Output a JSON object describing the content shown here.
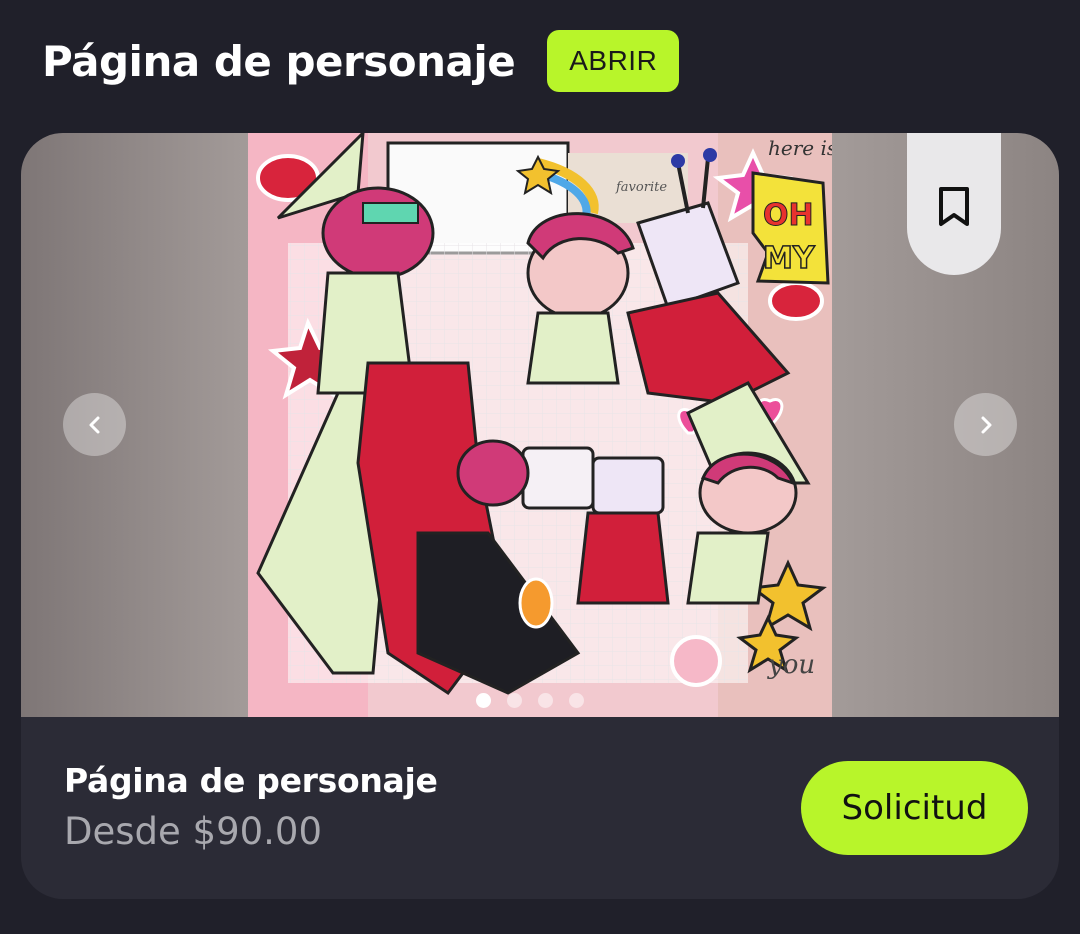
{
  "header": {
    "title": "Página de personaje",
    "badge": "ABRIR"
  },
  "carousel": {
    "image_alt": "Character page artwork",
    "total_slides": 4,
    "active_slide": 1,
    "artwork_text": {
      "oh_my": "OH MY",
      "here_is": "here is",
      "favorite": "favorite",
      "you": "you"
    }
  },
  "product": {
    "title": "Página de personaje",
    "price": "Desde $90.00",
    "request_label": "Solicitud"
  },
  "colors": {
    "accent": "#b8f52a",
    "background": "#20202a",
    "card": "#2b2b36"
  },
  "icons": {
    "prev": "chevron-left-icon",
    "next": "chevron-right-icon",
    "bookmark": "bookmark-icon"
  }
}
